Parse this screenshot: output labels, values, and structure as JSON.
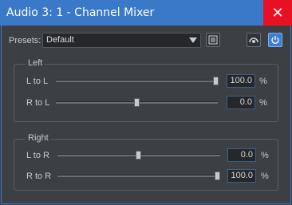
{
  "window": {
    "title": "Audio 3: 1 - Channel Mixer",
    "close_label": "✕"
  },
  "presets": {
    "label": "Presets:",
    "value": "Default"
  },
  "icons": {
    "list": "list-icon",
    "view": "eye-icon",
    "power": "power-icon"
  },
  "groups": {
    "left": {
      "title": "Left",
      "rows": [
        {
          "label": "L to L",
          "value": "100.0",
          "unit": "%",
          "level": 1.0
        },
        {
          "label": "R to L",
          "value": "0.0",
          "unit": "%",
          "level": 0.5
        }
      ]
    },
    "right": {
      "title": "Right",
      "rows": [
        {
          "label": "L to R",
          "value": "0.0",
          "unit": "%",
          "level": 0.5
        },
        {
          "label": "R to R",
          "value": "100.0",
          "unit": "%",
          "level": 1.0
        }
      ]
    }
  },
  "colors": {
    "titlebar": "#3a78c8",
    "close": "#e81123",
    "power_active": "#3b7fd0"
  }
}
